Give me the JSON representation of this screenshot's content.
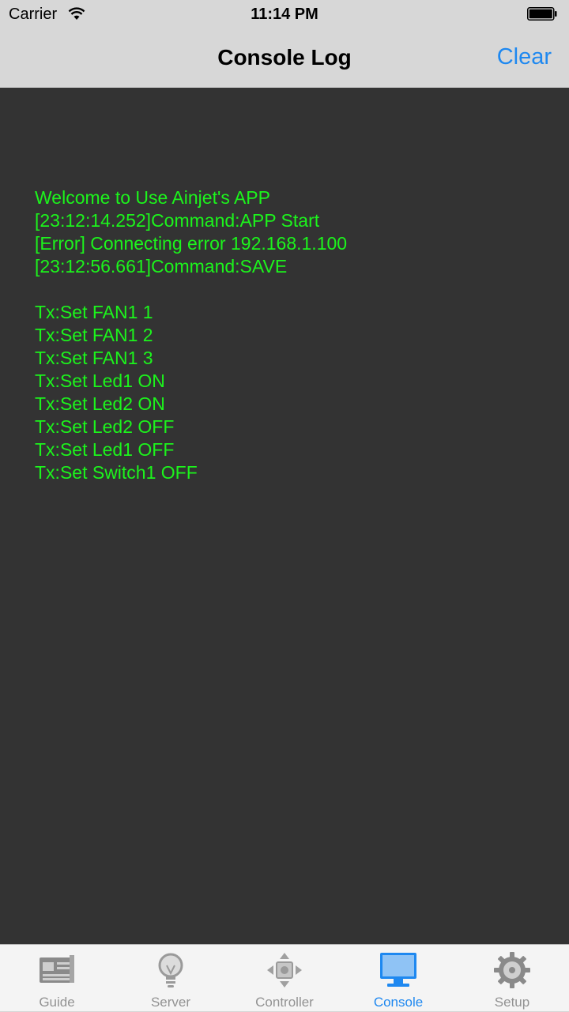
{
  "status_bar": {
    "carrier": "Carrier",
    "time": "11:14 PM"
  },
  "nav": {
    "title": "Console Log",
    "clear_label": "Clear"
  },
  "console": {
    "text_color": "#1cf41c",
    "background_color": "#333333",
    "lines": [
      "Welcome to Use Ainjet's APP",
      "[23:12:14.252]Command:APP Start",
      "[Error] Connecting error 192.168.1.100",
      "[23:12:56.661]Command:SAVE",
      "",
      "Tx:Set FAN1 1",
      "Tx:Set FAN1 2",
      "Tx:Set FAN1 3",
      "Tx:Set Led1 ON",
      "Tx:Set Led2 ON",
      "Tx:Set Led2 OFF",
      "Tx:Set Led1 OFF",
      "Tx:Set Switch1 OFF"
    ]
  },
  "tabs": [
    {
      "label": "Guide",
      "icon": "newspaper-icon",
      "active": false
    },
    {
      "label": "Server",
      "icon": "lightbulb-icon",
      "active": false
    },
    {
      "label": "Controller",
      "icon": "dpad-icon",
      "active": false
    },
    {
      "label": "Console",
      "icon": "monitor-icon",
      "active": true
    },
    {
      "label": "Setup",
      "icon": "gear-icon",
      "active": false
    }
  ],
  "colors": {
    "accent": "#1e88f0",
    "bar_background": "#d7d7d7",
    "tab_inactive": "#929292"
  }
}
